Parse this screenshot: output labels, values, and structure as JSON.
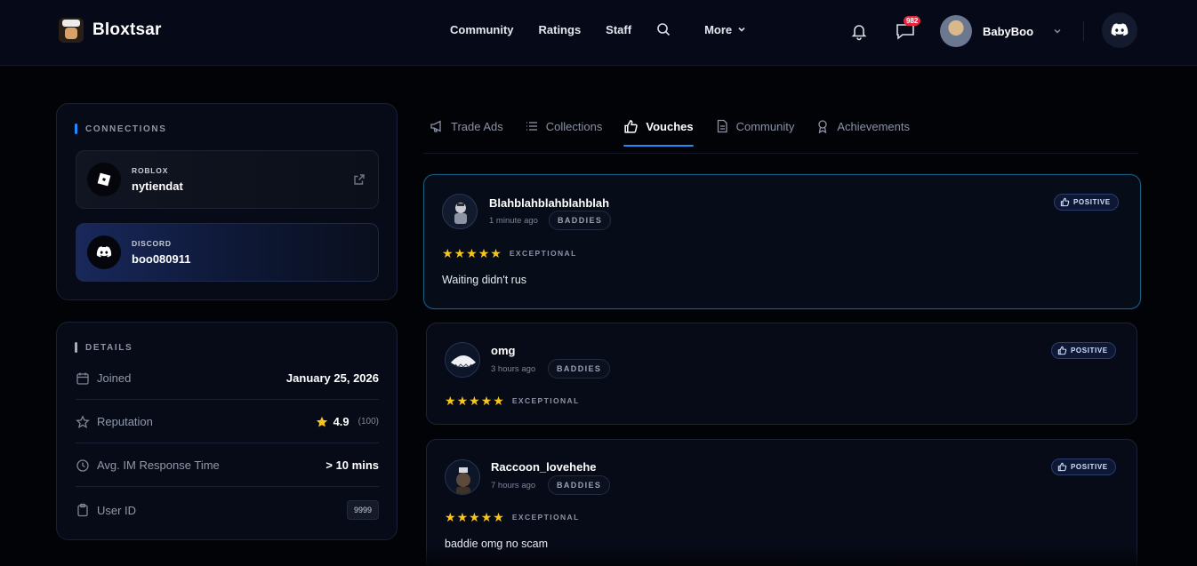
{
  "header": {
    "brand": "Bloxtsar",
    "nav": [
      {
        "label": "Community"
      },
      {
        "label": "Ratings"
      },
      {
        "label": "Staff"
      }
    ],
    "more_label": "More",
    "message_badge": "982",
    "username": "BabyBoo"
  },
  "connections": {
    "title": "CONNECTIONS",
    "items": [
      {
        "label": "ROBLOX",
        "value": "nytiendat"
      },
      {
        "label": "DISCORD",
        "value": "boo080911"
      }
    ]
  },
  "details": {
    "title": "DETAILS",
    "joined_label": "Joined",
    "joined_value": "January 25, 2026",
    "reputation_label": "Reputation",
    "reputation_value": "4.9",
    "reputation_count": "(100)",
    "response_label": "Avg. IM Response Time",
    "response_value": "> 10 mins",
    "userid_label": "User ID",
    "userid_value": "9999"
  },
  "tabs": [
    {
      "label": "Trade Ads"
    },
    {
      "label": "Collections"
    },
    {
      "label": "Vouches",
      "active": true
    },
    {
      "label": "Community"
    },
    {
      "label": "Achievements"
    }
  ],
  "vouches": [
    {
      "name": "Blahblahblahblahblah",
      "time": "1 minute ago",
      "tag": "BADDIES",
      "stars": 5,
      "grade": "EXCEPTIONAL",
      "comment": "Waiting didn't rus",
      "sentiment": "POSITIVE"
    },
    {
      "name": "omg",
      "time": "3 hours ago",
      "tag": "BADDIES",
      "stars": 5,
      "grade": "EXCEPTIONAL",
      "comment": "",
      "sentiment": "POSITIVE"
    },
    {
      "name": "Raccoon_lovehehe",
      "time": "7 hours ago",
      "tag": "BADDIES",
      "stars": 5,
      "grade": "EXCEPTIONAL",
      "comment": "baddie omg no scam",
      "sentiment": "POSITIVE"
    }
  ],
  "colors": {
    "accent": "#1f8bff",
    "star": "#f7c51c",
    "badge": "#e3263f"
  }
}
